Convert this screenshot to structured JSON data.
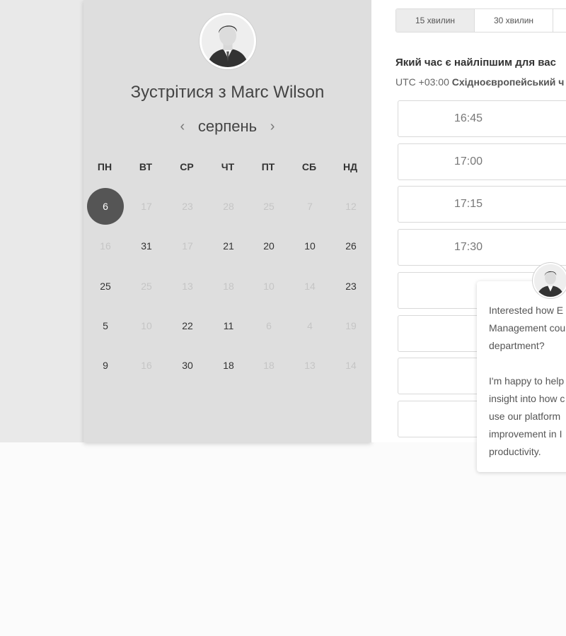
{
  "host": {
    "title": "Зустрітися з Marc Wilson",
    "avatar_icon": "person-avatar-icon"
  },
  "calendar": {
    "month": "серпень",
    "prev_icon": "‹",
    "next_icon": "›",
    "weekdays": [
      "ПН",
      "ВТ",
      "СР",
      "ЧТ",
      "ПТ",
      "СБ",
      "НД"
    ],
    "weeks": [
      [
        {
          "d": "6",
          "s": "selected"
        },
        {
          "d": "17",
          "s": "unavailable"
        },
        {
          "d": "23",
          "s": "unavailable"
        },
        {
          "d": "28",
          "s": "unavailable"
        },
        {
          "d": "25",
          "s": "unavailable"
        },
        {
          "d": "7",
          "s": "unavailable"
        },
        {
          "d": "12",
          "s": "unavailable"
        }
      ],
      [
        {
          "d": "16",
          "s": "unavailable"
        },
        {
          "d": "31",
          "s": "available"
        },
        {
          "d": "17",
          "s": "unavailable"
        },
        {
          "d": "21",
          "s": "available"
        },
        {
          "d": "20",
          "s": "available"
        },
        {
          "d": "10",
          "s": "available"
        },
        {
          "d": "26",
          "s": "available"
        }
      ],
      [
        {
          "d": "25",
          "s": "available"
        },
        {
          "d": "25",
          "s": "unavailable"
        },
        {
          "d": "13",
          "s": "unavailable"
        },
        {
          "d": "18",
          "s": "unavailable"
        },
        {
          "d": "10",
          "s": "unavailable"
        },
        {
          "d": "14",
          "s": "unavailable"
        },
        {
          "d": "23",
          "s": "available"
        }
      ],
      [
        {
          "d": "5",
          "s": "available"
        },
        {
          "d": "10",
          "s": "unavailable"
        },
        {
          "d": "22",
          "s": "available"
        },
        {
          "d": "11",
          "s": "available"
        },
        {
          "d": "6",
          "s": "unavailable"
        },
        {
          "d": "4",
          "s": "unavailable"
        },
        {
          "d": "19",
          "s": "unavailable"
        }
      ],
      [
        {
          "d": "9",
          "s": "available"
        },
        {
          "d": "16",
          "s": "unavailable"
        },
        {
          "d": "30",
          "s": "available"
        },
        {
          "d": "18",
          "s": "available"
        },
        {
          "d": "18",
          "s": "unavailable"
        },
        {
          "d": "13",
          "s": "unavailable"
        },
        {
          "d": "14",
          "s": "unavailable"
        }
      ]
    ]
  },
  "durations": {
    "tabs": [
      "15 хвилин",
      "30 хвилин",
      ""
    ],
    "active_index": 0
  },
  "schedule": {
    "question": "Який час є найліпшим для вас",
    "tz_prefix": "UTC +03:00",
    "tz_name": "Східноєвропейський ч",
    "slots": [
      "16:45",
      "17:00",
      "17:15",
      "17:30",
      "",
      "",
      "",
      ""
    ]
  },
  "chat": {
    "avatar_icon": "person-avatar-icon",
    "lines": [
      "Interested how E",
      "Management cou",
      "department?",
      "",
      "I'm happy to help",
      "insight into how c",
      "use our platform",
      "improvement in I",
      "productivity."
    ]
  },
  "colors": {
    "selected_day": "#555555",
    "calendar_bg": "#dedede",
    "unavailable_day": "#c5c5c5"
  }
}
